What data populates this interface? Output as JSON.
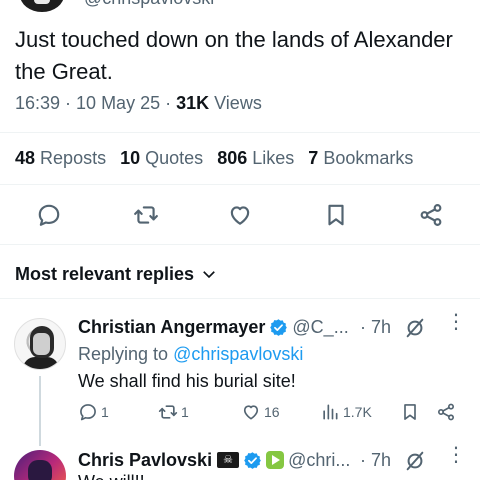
{
  "main_tweet": {
    "author_handle": "@chrispavlovski",
    "text": "Just touched down on the lands of Alexander the Great.",
    "time": "16:39 · 10 May 25 · ",
    "views_count": "31K",
    "views_label": " Views"
  },
  "stats": [
    {
      "count": "48",
      "label": "Reposts"
    },
    {
      "count": "10",
      "label": "Quotes"
    },
    {
      "count": "806",
      "label": "Likes"
    },
    {
      "count": "7",
      "label": "Bookmarks"
    }
  ],
  "actions": [
    "reply-icon",
    "repost-icon",
    "like-icon",
    "bookmark-icon",
    "share-icon"
  ],
  "sort": {
    "label": "Most relevant replies"
  },
  "replies": [
    {
      "name": "Christian Angermayer",
      "handle": "@C_...",
      "time": "· 7h",
      "replying_prefix": "Replying to ",
      "replying_handle": "@chrispavlovski",
      "text": "We shall find his burial site!",
      "reply_count": "1",
      "repost_count": "1",
      "like_count": "16",
      "view_count": "1.7K"
    },
    {
      "name": "Chris Pavlovski",
      "flag_glyph": "☠",
      "handle": "@chri...",
      "time": "· 7h",
      "text": "We will!!"
    }
  ],
  "colors": {
    "accent": "#1d9bf0",
    "text": "#0f1419",
    "muted": "#536471",
    "divider": "#eff3f4",
    "rumble": "#85c742"
  }
}
